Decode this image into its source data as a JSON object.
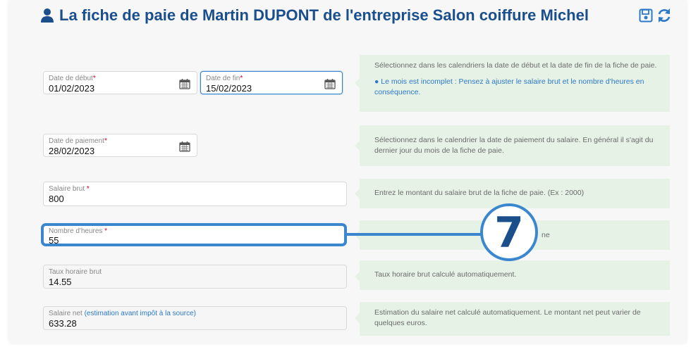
{
  "header": {
    "title": "La fiche de paie de Martin DUPONT de l'entreprise Salon coiffure Michel",
    "icons": [
      "user-icon",
      "save-icon",
      "refresh-icon"
    ],
    "title_color": "#1b4f8c"
  },
  "fields": {
    "date_debut": {
      "label": "Date de début",
      "required": "*",
      "value": "01/02/2023"
    },
    "date_fin": {
      "label": "Date de fin",
      "required": "*",
      "value": "15/02/2023"
    },
    "date_paiement": {
      "label": "Date de paiement",
      "required": "*",
      "value": "28/02/2023"
    },
    "salaire_brut": {
      "label": "Salaire brut ",
      "required": "*",
      "value": "800"
    },
    "nombre_heures": {
      "label": "Nombre d'heures ",
      "required": "*",
      "value": "55"
    },
    "taux_horaire": {
      "label": "Taux horaire brut",
      "value": "14.55"
    },
    "salaire_net": {
      "label": "Salaire net ",
      "link": "(estimation avant impôt à la source)",
      "value": "633.28"
    }
  },
  "hints": {
    "dates": "Sélectionnez dans les calendriers la date de début et la date de fin de la fiche de paie.",
    "dates_note": "Le mois est incomplet : Pensez à ajuster le salaire brut et le nombre d'heures en conséquence.",
    "paiement": "Sélectionnez dans le calendrier la date de paiement du salaire. En général il s'agit du dernier jour du mois de la fiche de paie.",
    "salaire_brut": "Entrez le montant du salaire brut de la fiche de paie. (Ex : 2000)",
    "nombre_heures": "ne",
    "taux_horaire": "Taux horaire brut calculé automatiquement.",
    "salaire_net": "Estimation du salaire net calculé automatiquement. Le montant net peut varier de quelques euros."
  },
  "annotation": {
    "step_number": "7",
    "color": "#3a87d0"
  }
}
